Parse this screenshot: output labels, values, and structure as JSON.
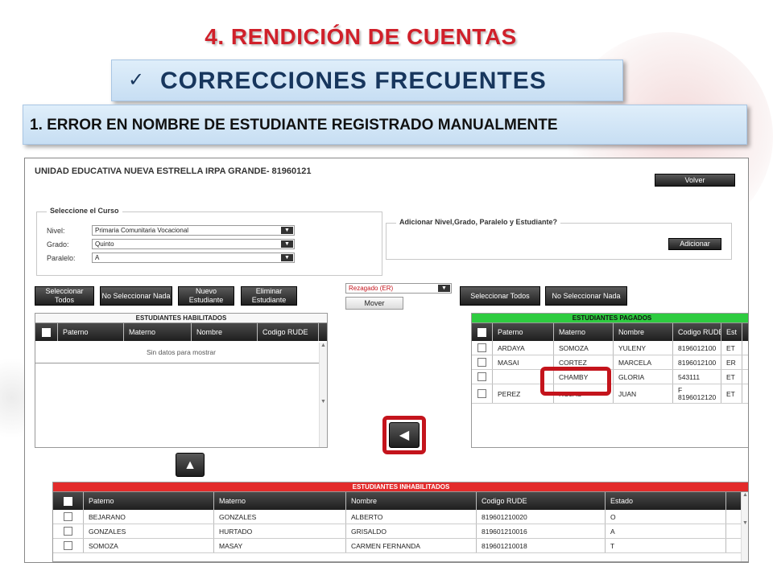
{
  "slide": {
    "title": "4. RENDICIÓN  DE CUENTAS",
    "subtitle": "CORRECCIONES FRECUENTES",
    "subtitle_icon": "check-icon",
    "section": "1. ERROR EN NOMBRE DE ESTUDIANTE REGISTRADO MANUALMENTE"
  },
  "app": {
    "school_label": "UNIDAD EDUCATIVA NUEVA ESTRELLA IRPA GRANDE- 81960121",
    "volver": "Volver",
    "course": {
      "legend": "Seleccione el Curso",
      "nivel_label": "Nivel:",
      "nivel_value": "Primaria Comunitaria Vocacional",
      "grado_label": "Grado:",
      "grado_value": "Quinto",
      "paralelo_label": "Paralelo:",
      "paralelo_value": "A"
    },
    "add_panel": {
      "legend": "Adicionar Nivel,Grado, Paralelo y Estudiante?",
      "button": "Adicionar"
    },
    "actions": {
      "select_all": "Seleccionar Todos",
      "select_none": "No Seleccionar Nada",
      "new_student": "Nuevo Estudiante",
      "delete_student": "Eliminar Estudiante",
      "status_select": "Rezagado (ER)",
      "move": "Mover",
      "select_all_right": "Seleccionar Todos",
      "select_none_right": "No Seleccionar Nada"
    },
    "habilitados": {
      "title": "ESTUDIANTES HABILITADOS",
      "columns": [
        "Paterno",
        "Materno",
        "Nombre",
        "Codigo RUDE"
      ],
      "empty": "Sin datos para mostrar"
    },
    "pagados": {
      "title": "ESTUDIANTES PAGADOS",
      "columns": [
        "Paterno",
        "Materno",
        "Nombre",
        "Codigo RUDE",
        "Est"
      ],
      "rows": [
        [
          "ARDAYA",
          "SOMOZA",
          "YULENY",
          "8196012100",
          "ET"
        ],
        [
          "MASAI",
          "CORTEZ",
          "MARCELA",
          "8196012100",
          "ER"
        ],
        [
          "",
          "CHAMBY",
          "GLORIA",
          "543111",
          "ET"
        ],
        [
          "PEREZ",
          "ROJAS",
          "JUAN",
          "F 8196012120",
          "ET"
        ]
      ]
    },
    "inhabilitados": {
      "title": "ESTUDIANTES INHABILITADOS",
      "columns": [
        "Paterno",
        "Materno",
        "Nombre",
        "Codigo RUDE",
        "Estado"
      ],
      "rows": [
        [
          "BEJARANO",
          "GONZALES",
          "ALBERTO",
          "819601210020",
          "O"
        ],
        [
          "GONZALES",
          "HURTADO",
          "GRISALDO",
          "819601210016",
          "A"
        ],
        [
          "SOMOZA",
          "MASAY",
          "CARMEN FERNANDA",
          "819601210018",
          "T"
        ]
      ]
    },
    "colors": {
      "accent_red": "#c4141c",
      "paid_green": "#2ecc40",
      "disabled_red": "#e32b2b"
    }
  }
}
